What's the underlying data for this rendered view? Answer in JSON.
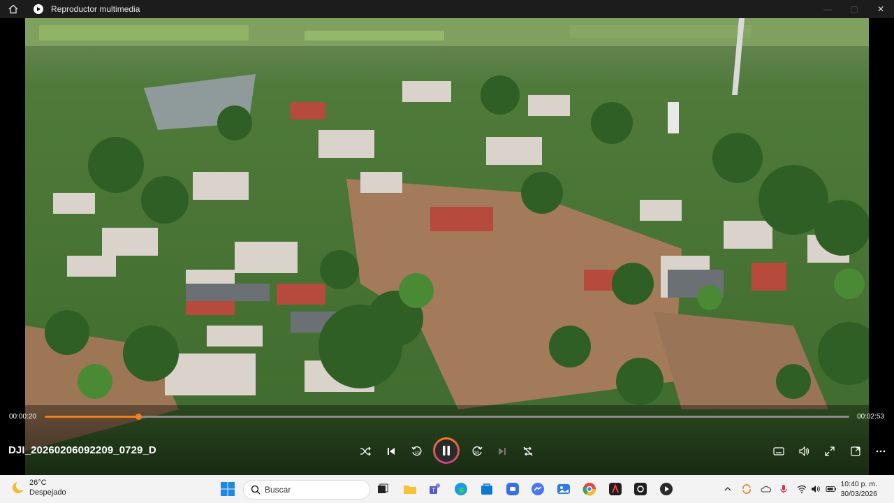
{
  "window": {
    "title": "Reproductor multimedia"
  },
  "player": {
    "current_time": "00:00:20",
    "total_time": "00:02:53",
    "progress": 0.116,
    "filename": "DJI_20260206092209_0729_D",
    "state": "playing",
    "accent_color": "#f0801e"
  },
  "icons": [
    "home-icon",
    "shuffle-icon",
    "previous-icon",
    "rewind-10-icon",
    "pause-icon",
    "forward-30-icon",
    "next-icon",
    "repeat-off-icon",
    "subtitles-icon",
    "volume-icon",
    "fullscreen-icon",
    "miniplayer-icon",
    "more-icon"
  ],
  "taskbar": {
    "weather_temp": "26°C",
    "weather_desc": "Despejado",
    "search_placeholder": "Buscar",
    "time": "10:40 p. m.",
    "date": "30/03/2026"
  }
}
